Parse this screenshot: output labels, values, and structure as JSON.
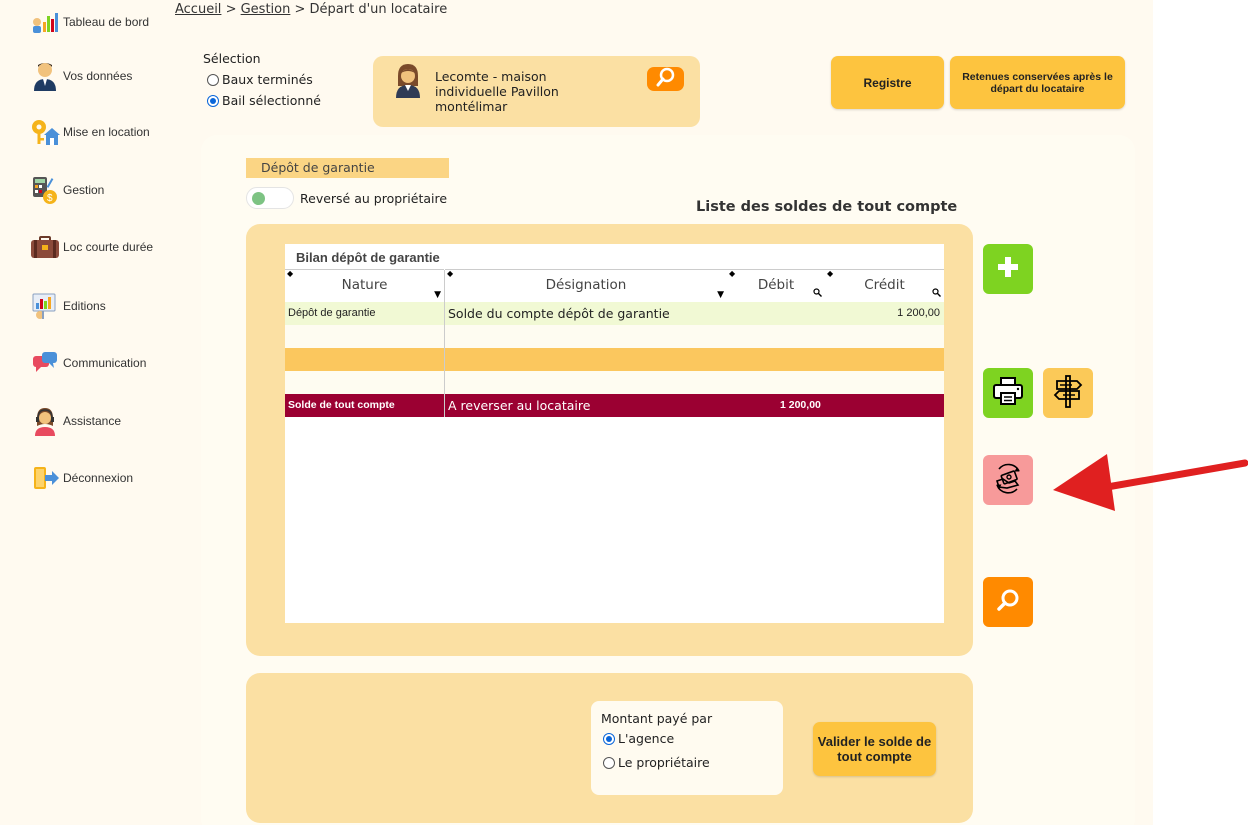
{
  "sidebar": {
    "items": [
      {
        "label": "Tableau de bord",
        "icon": "dashboard-icon"
      },
      {
        "label": "Vos données",
        "icon": "user-icon"
      },
      {
        "label": "Mise en location",
        "icon": "house-key-icon"
      },
      {
        "label": "Gestion",
        "icon": "calculator-icon"
      },
      {
        "label": "Loc courte durée",
        "icon": "suitcase-icon"
      },
      {
        "label": "Editions",
        "icon": "report-icon"
      },
      {
        "label": "Communication",
        "icon": "chat-icon"
      },
      {
        "label": "Assistance",
        "icon": "headset-icon"
      },
      {
        "label": "Déconnexion",
        "icon": "logout-icon"
      }
    ]
  },
  "breadcrumb": {
    "home": "Accueil",
    "sep": ">",
    "gestion": "Gestion",
    "current": "Départ d'un locataire"
  },
  "selection": {
    "title": "Sélection",
    "options": [
      "Baux terminés",
      "Bail sélectionné"
    ],
    "selected": "Bail sélectionné"
  },
  "tenant": {
    "line1": "Lecomte - maison",
    "line2": "individuelle Pavillon",
    "line3": "montélimar"
  },
  "buttons": {
    "registre": "Registre",
    "retenues": "Retenues conservées après le départ du locataire",
    "valider": "Valider le solde de tout compte"
  },
  "depot": {
    "label": "Dépôt de garantie",
    "toggle_label": "Reversé au propriétaire"
  },
  "list_title": "Liste des soldes de tout compte",
  "table": {
    "title": "Bilan dépôt de garantie",
    "columns": [
      "Nature",
      "Désignation",
      "Débit",
      "Crédit"
    ],
    "rows": [
      {
        "nature": "Dépôt de garantie",
        "designation": "Solde du compte dépôt de garantie",
        "debit": "",
        "credit": "1 200,00"
      }
    ],
    "total": {
      "nature": "Solde de tout compte",
      "designation": "A reverser au locataire",
      "debit": "1 200,00",
      "credit": ""
    }
  },
  "paid_by": {
    "title": "Montant payé par",
    "options": [
      "L'agence",
      "Le propriétaire"
    ],
    "selected": "L'agence"
  },
  "colors": {
    "accent_yellow": "#fdc43f",
    "panel_yellow": "#fbe0a3",
    "green": "#7ed321",
    "orange": "#ff8a00",
    "total_row": "#9b0032",
    "highlight_row": "#fbc75e",
    "arrow": "#e02020"
  }
}
